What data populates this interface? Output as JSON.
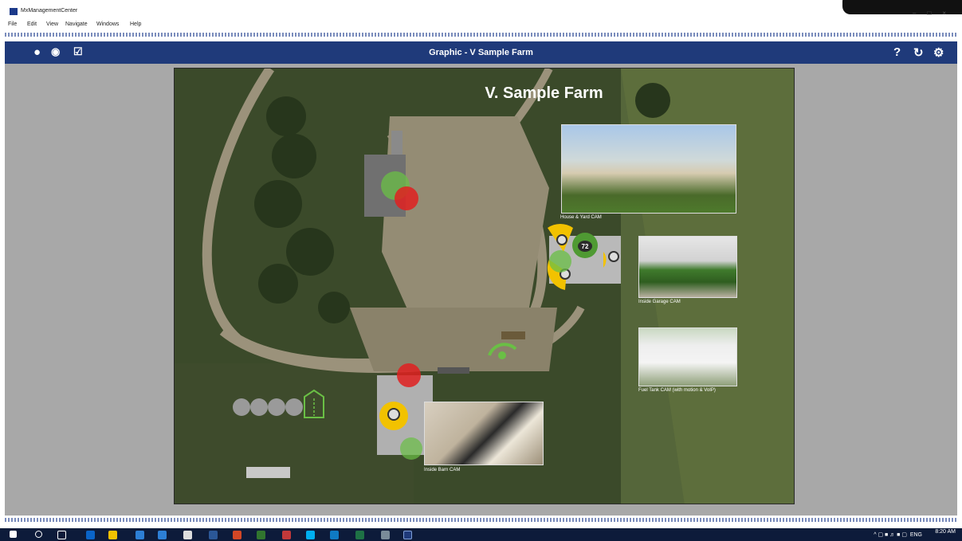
{
  "window": {
    "title": "MxManagementCenter"
  },
  "menu": [
    "File",
    "Edit",
    "View",
    "Navigate",
    "Windows",
    "Help"
  ],
  "header": {
    "title": "Graphic - V Sample Farm"
  },
  "map": {
    "title": "V. Sample Farm",
    "thermostat_value": "72"
  },
  "cameras": [
    {
      "label": "House & Yard CAM"
    },
    {
      "label": "Inside Garage CAM"
    },
    {
      "label": "Fuel Tank CAM (with motion & VoIP)"
    },
    {
      "label": "Inside Barn CAM"
    }
  ],
  "taskbar": {
    "tray_lang": "ENG",
    "time": "8:20 AM"
  },
  "colors": {
    "header": "#1f3a7a",
    "sensor_green": "#6abf45",
    "sensor_red": "#e02020",
    "sensor_yellow": "#f2c200"
  }
}
